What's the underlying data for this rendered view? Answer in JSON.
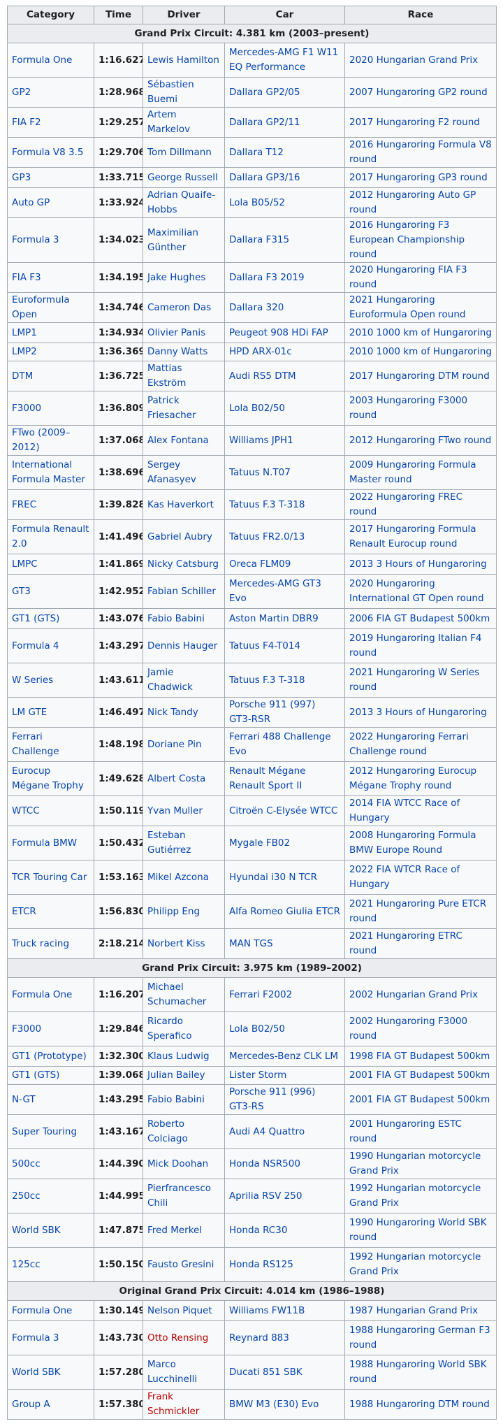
{
  "headers": [
    "Category",
    "Time",
    "Driver",
    "Car",
    "Race"
  ],
  "sections": [
    {
      "title": "Grand Prix Circuit: 4.381 km (2003–present)",
      "rows": [
        {
          "category": "Formula One",
          "time": "1:16.627",
          "driver": "Lewis Hamilton",
          "car": "Mercedes-AMG F1 W11 EQ Performance",
          "race": "2020 Hungarian Grand Prix",
          "h": "r2"
        },
        {
          "category": "GP2",
          "time": "1:28.968",
          "driver": "Sébastien Buemi",
          "car": "Dallara GP2/05",
          "race": "2007 Hungaroring GP2 round",
          "h": "s"
        },
        {
          "category": "FIA F2",
          "time": "1:29.257",
          "driver": "Artem Markelov",
          "car": "Dallara GP2/11",
          "race": "2017 Hungaroring F2 round",
          "h": "s"
        },
        {
          "category": "Formula V8 3.5",
          "time": "1:29.706",
          "driver": "Tom Dillmann",
          "car": "Dallara T12",
          "race": "2016 Hungaroring Formula V8 round",
          "h": "r1"
        },
        {
          "category": "GP3",
          "time": "1:33.715",
          "driver": "George Russell",
          "car": "Dallara GP3/16",
          "race": "2017 Hungaroring GP3 round",
          "h": "sm"
        },
        {
          "category": "Auto GP",
          "time": "1:33.924",
          "driver": "Adrian Quaife-Hobbs",
          "car": "Lola B05/52",
          "race": "2012 Hungaroring Auto GP round",
          "h": "r1"
        },
        {
          "category": "Formula 3",
          "time": "1:34.023",
          "driver": "Maximilian Günther",
          "car": "Dallara F315",
          "race": "2016 Hungaroring F3 European Championship round",
          "h": "r1"
        },
        {
          "category": "FIA F3",
          "time": "1:34.195",
          "driver": "Jake Hughes",
          "car": "Dallara F3 2019",
          "race": "2020 Hungaroring FIA F3 round",
          "h": "sm"
        },
        {
          "category": "Euroformula Open",
          "time": "1:34.746",
          "driver": "Cameron Das",
          "car": "Dallara 320",
          "race": "2021 Hungaroring Euroformula Open round",
          "h": "r1"
        },
        {
          "category": "LMP1",
          "time": "1:34.934",
          "driver": "Olivier Panis",
          "car": "Peugeot 908 HDi FAP",
          "race": "2010 1000 km of Hungaroring",
          "h": "sm"
        },
        {
          "category": "LMP2",
          "time": "1:36.369",
          "driver": "Danny Watts",
          "car": "HPD ARX-01c",
          "race": "2010 1000 km of Hungaroring",
          "h": "s"
        },
        {
          "category": "DTM",
          "time": "1:36.725",
          "driver": "Mattias Ekström",
          "car": "Audi RS5 DTM",
          "race": "2017 Hungaroring DTM round",
          "h": "s"
        },
        {
          "category": "F3000",
          "time": "1:36.809",
          "driver": "Patrick Friesacher",
          "car": "Lola B02/50",
          "race": "2003 Hungaroring F3000 round",
          "h": "r2"
        },
        {
          "category": "FTwo (2009–2012)",
          "time": "1:37.068",
          "driver": "Alex Fontana",
          "car": "Williams JPH1",
          "race": "2012 Hungaroring FTwo round",
          "h": "sm"
        },
        {
          "category": "International Formula Master",
          "time": "1:38.696",
          "driver": "Sergey Afanasyev",
          "car": "Tatuus N.T07",
          "race": "2009 Hungaroring Formula Master round",
          "h": "r2"
        },
        {
          "category": "FREC",
          "time": "1:39.828",
          "driver": "Kas Haverkort",
          "car": "Tatuus F.3 T-318",
          "race": "2022 Hungaroring FREC round",
          "h": "sm"
        },
        {
          "category": "Formula Renault 2.0",
          "time": "1:41.496",
          "driver": "Gabriel Aubry",
          "car": "Tatuus FR2.0/13",
          "race": "2017 Hungaroring Formula Renault Eurocup round",
          "h": "r2"
        },
        {
          "category": "LMPC",
          "time": "1:41.869",
          "driver": "Nicky Catsburg",
          "car": "Oreca FLM09",
          "race": "2013 3 Hours of Hungaroring",
          "h": "sm"
        },
        {
          "category": "GT3",
          "time": "1:42.952",
          "driver": "Fabian Schiller",
          "car": "Mercedes-AMG GT3 Evo",
          "race": "2020 Hungaroring International GT Open round",
          "h": "r2"
        },
        {
          "category": "GT1 (GTS)",
          "time": "1:43.076",
          "driver": "Fabio Babini",
          "car": "Aston Martin DBR9",
          "race": "2006 FIA GT Budapest 500km",
          "h": "sm"
        },
        {
          "category": "Formula 4",
          "time": "1:43.297",
          "driver": "Dennis Hauger",
          "car": "Tatuus F4-T014",
          "race": "2019 Hungaroring Italian F4 round",
          "h": "r2"
        },
        {
          "category": "W Series",
          "time": "1:43.611",
          "driver": "Jamie Chadwick",
          "car": "Tatuus F.3 T-318",
          "race": "2021 Hungaroring W Series round",
          "h": "r2"
        },
        {
          "category": "LM GTE",
          "time": "1:46.497",
          "driver": "Nick Tandy",
          "car": "Porsche 911 (997) GT3-RSR",
          "race": "2013 3 Hours of Hungaroring",
          "h": "r1"
        },
        {
          "category": "Ferrari Challenge",
          "time": "1:48.198",
          "driver": "Doriane Pin",
          "car": "Ferrari 488 Challenge Evo",
          "race": "2022 Hungaroring Ferrari Challenge round",
          "h": "r2"
        },
        {
          "category": "Eurocup Mégane Trophy",
          "time": "1:49.628",
          "driver": "Albert Costa",
          "car": "Renault Mégane Renault Sport II",
          "race": "2012 Hungaroring Eurocup Mégane Trophy round",
          "h": "r2"
        },
        {
          "category": "WTCC",
          "time": "1:50.119",
          "driver": "Yvan Muller",
          "car": "Citroën C-Elysée WTCC",
          "race": "2014 FIA WTCC Race of Hungary",
          "h": "r1"
        },
        {
          "category": "Formula BMW",
          "time": "1:50.432",
          "driver": "Esteban Gutiérrez",
          "car": "Mygale FB02",
          "race": "2008 Hungaroring Formula BMW Europe Round",
          "h": "r2"
        },
        {
          "category": "TCR Touring Car",
          "time": "1:53.163",
          "driver": "Mikel Azcona",
          "car": "Hyundai i30 N TCR",
          "race": "2022 FIA WTCR Race of Hungary",
          "h": "r2"
        },
        {
          "category": "ETCR",
          "time": "1:56.830",
          "driver": "Philipp Eng",
          "car": "Alfa Romeo Giulia ETCR",
          "race": "2021 Hungaroring Pure ETCR round",
          "h": "r2"
        },
        {
          "category": "Truck racing",
          "time": "2:18.214",
          "driver": "Norbert Kiss",
          "car": "MAN TGS",
          "race": "2021 Hungaroring ETRC round",
          "h": "sm"
        }
      ]
    },
    {
      "title": "Grand Prix Circuit: 3.975 km (1989–2002)",
      "rows": [
        {
          "category": "Formula One",
          "time": "1:16.207",
          "driver": "Michael Schumacher",
          "car": "Ferrari F2002",
          "race": "2002 Hungarian Grand Prix",
          "h": "r2"
        },
        {
          "category": "F3000",
          "time": "1:29.846",
          "driver": "Ricardo Sperafico",
          "car": "Lola B02/50",
          "race": "2002 Hungaroring F3000 round",
          "h": "r2"
        },
        {
          "category": "GT1 (Prototype)",
          "time": "1:32.300",
          "driver": "Klaus Ludwig",
          "car": "Mercedes-Benz CLK LM",
          "race": "1998 FIA GT Budapest 500km",
          "h": "sm"
        },
        {
          "category": "GT1 (GTS)",
          "time": "1:39.068",
          "driver": "Julian Bailey",
          "car": "Lister Storm",
          "race": "2001 FIA GT Budapest 500km",
          "h": "s"
        },
        {
          "category": "N-GT",
          "time": "1:43.295",
          "driver": "Fabio Babini",
          "car": "Porsche 911 (996) GT3-RS",
          "race": "2001 FIA GT Budapest 500km",
          "h": "r1"
        },
        {
          "category": "Super Touring",
          "time": "1:43.167",
          "driver": "Roberto Colciago",
          "car": "Audi A4 Quattro",
          "race": "2001 Hungaroring ESTC round",
          "h": "r2"
        },
        {
          "category": "500cc",
          "time": "1:44.390",
          "driver": "Mick Doohan",
          "car": "Honda NSR500",
          "race": "1990 Hungarian motorcycle Grand Prix",
          "h": "r1"
        },
        {
          "category": "250cc",
          "time": "1:44.995",
          "driver": "Pierfrancesco Chili",
          "car": "Aprilia RSV 250",
          "race": "1992 Hungarian motorcycle Grand Prix",
          "h": "r2"
        },
        {
          "category": "World SBK",
          "time": "1:47.875",
          "driver": "Fred Merkel",
          "car": "Honda RC30",
          "race": "1990 Hungaroring World SBK round",
          "h": "r2"
        },
        {
          "category": "125cc",
          "time": "1:50.150",
          "driver": "Fausto Gresini",
          "car": "Honda RS125",
          "race": "1992 Hungarian motorcycle Grand Prix",
          "h": "r2"
        }
      ]
    },
    {
      "title": "Original Grand Prix Circuit: 4.014 km (1986–1988)",
      "rows": [
        {
          "category": "Formula One",
          "time": "1:30.149",
          "driver": "Nelson Piquet",
          "car": "Williams FW11B",
          "race": "1987 Hungarian Grand Prix",
          "h": "sm"
        },
        {
          "category": "Formula 3",
          "time": "1:43.730",
          "driver": "Otto Rensing",
          "car": "Reynard 883",
          "race": "1988 Hungaroring German F3 round",
          "h": "r2",
          "driver_red": true
        },
        {
          "category": "World SBK",
          "time": "1:57.280",
          "driver": "Marco Lucchinelli",
          "car": "Ducati 851 SBK",
          "race": "1988 Hungaroring World SBK round",
          "h": "r2"
        },
        {
          "category": "Group A",
          "time": "1:57.380",
          "driver": "Frank Schmickler",
          "car": "BMW M3 (E30) Evo",
          "race": "1988 Hungaroring DTM round",
          "h": "s",
          "driver_red": true
        }
      ]
    }
  ]
}
